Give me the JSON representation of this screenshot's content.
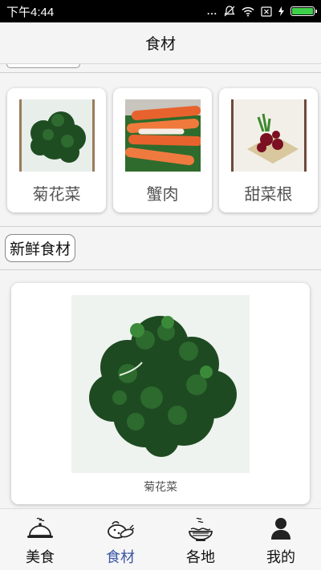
{
  "status_bar": {
    "time": "下午4:44",
    "dots": "...",
    "battery_level": 1.0
  },
  "header": {
    "title": "食材"
  },
  "recommend": {
    "items": [
      {
        "name": "菊花菜",
        "icon": "chrysanthemum-greens-image"
      },
      {
        "name": "蟹肉",
        "icon": "crab-meat-image"
      },
      {
        "name": "甜菜根",
        "icon": "beetroot-image"
      }
    ]
  },
  "section": {
    "label": "新鲜食材"
  },
  "feature": {
    "caption": "菊花菜",
    "icon": "chrysanthemum-greens-image"
  },
  "tabs": [
    {
      "label": "美食",
      "icon": "cloche-icon",
      "active": false
    },
    {
      "label": "食材",
      "icon": "vegetables-icon",
      "active": true
    },
    {
      "label": "各地",
      "icon": "noodle-bowl-icon",
      "active": false
    },
    {
      "label": "我的",
      "icon": "person-icon",
      "active": false
    }
  ],
  "colors": {
    "accent": "#3a55a7",
    "battery": "#3fd04a"
  }
}
